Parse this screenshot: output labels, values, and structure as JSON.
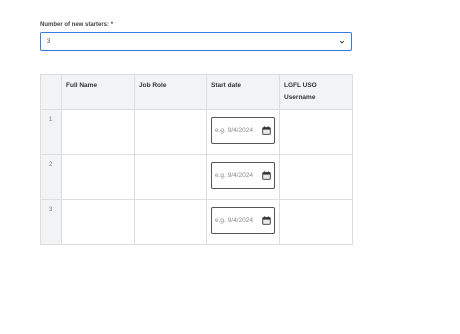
{
  "form": {
    "label": "Number of new starters:",
    "required_mark": "*",
    "selected": "3",
    "dropdown_icon": "chevron-down-icon"
  },
  "table": {
    "headers": [
      "",
      "Full Name",
      "Job Role",
      "Start date",
      "LGFL USO Username"
    ],
    "rows": [
      {
        "index": "1",
        "date_placeholder": "e.g. 9/4/2024"
      },
      {
        "index": "2",
        "date_placeholder": "e.g. 9/4/2024"
      },
      {
        "index": "3",
        "date_placeholder": "e.g. 9/4/2024"
      }
    ],
    "calendar_icon": "calendar-icon"
  },
  "colors": {
    "accent": "#3a7be0",
    "header_bg": "#f2f3f5",
    "border": "#dddddd"
  }
}
